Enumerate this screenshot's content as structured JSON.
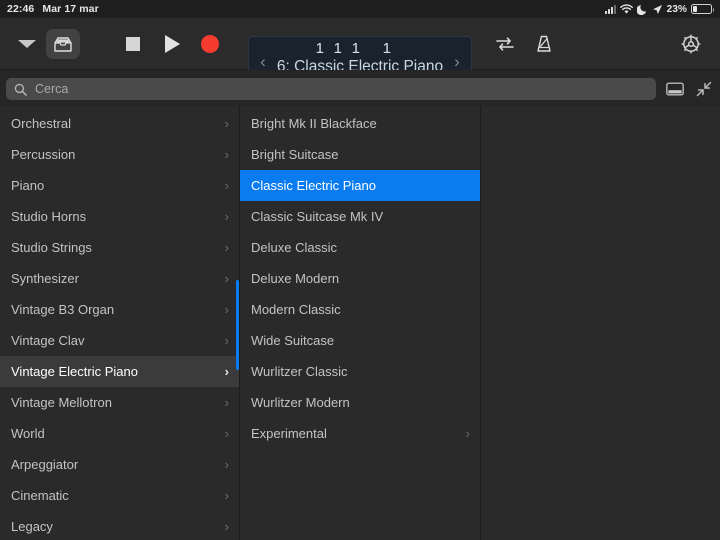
{
  "statusbar": {
    "time": "22:46",
    "date": "Mar 17 mar",
    "battery_percent": "23%",
    "icons": [
      "cellular-signal-icon",
      "wifi-icon",
      "moon-icon",
      "location-arrow-icon",
      "battery-icon"
    ]
  },
  "toolbar": {
    "chevron_down": "chevron-down-icon",
    "library_button": "library-icon",
    "stop_button": "stop-icon",
    "play_button": "play-icon",
    "record_button": "record-icon",
    "cycle_button": "cycle-icon",
    "metronome_button": "metronome-icon",
    "settings_button": "gear-icon",
    "accent_record_color": "#f53c2e"
  },
  "lcd": {
    "position": [
      "1",
      "1",
      "1",
      "1"
    ],
    "patch": "6: Classic Electric Piano",
    "prev_label": "‹",
    "next_label": "›",
    "background_color": "#1a222e"
  },
  "search": {
    "placeholder": "Cerca",
    "value": "",
    "icon": "search-icon",
    "keyboard_toggle_icon": "keyboard-hide-icon",
    "collapse_icon": "collapse-arrows-icon"
  },
  "browser": {
    "selection_color": "#0a7cf0",
    "categories": [
      {
        "label": "Orchestral",
        "has_children": true,
        "selected": false
      },
      {
        "label": "Percussion",
        "has_children": true,
        "selected": false
      },
      {
        "label": "Piano",
        "has_children": true,
        "selected": false
      },
      {
        "label": "Studio Horns",
        "has_children": true,
        "selected": false
      },
      {
        "label": "Studio Strings",
        "has_children": true,
        "selected": false
      },
      {
        "label": "Synthesizer",
        "has_children": true,
        "selected": false
      },
      {
        "label": "Vintage B3 Organ",
        "has_children": true,
        "selected": false
      },
      {
        "label": "Vintage Clav",
        "has_children": true,
        "selected": false
      },
      {
        "label": "Vintage Electric Piano",
        "has_children": true,
        "selected": true
      },
      {
        "label": "Vintage Mellotron",
        "has_children": true,
        "selected": false
      },
      {
        "label": "World",
        "has_children": true,
        "selected": false
      },
      {
        "label": "Arpeggiator",
        "has_children": true,
        "selected": false
      },
      {
        "label": "Cinematic",
        "has_children": true,
        "selected": false
      },
      {
        "label": "Legacy",
        "has_children": true,
        "selected": false
      }
    ],
    "patches": [
      {
        "label": "Bright Mk II Blackface",
        "has_children": false,
        "selected": false
      },
      {
        "label": "Bright Suitcase",
        "has_children": false,
        "selected": false
      },
      {
        "label": "Classic Electric Piano",
        "has_children": false,
        "selected": true
      },
      {
        "label": "Classic Suitcase Mk IV",
        "has_children": false,
        "selected": false
      },
      {
        "label": "Deluxe Classic",
        "has_children": false,
        "selected": false
      },
      {
        "label": "Deluxe Modern",
        "has_children": false,
        "selected": false
      },
      {
        "label": "Modern Classic",
        "has_children": false,
        "selected": false
      },
      {
        "label": "Wide Suitcase",
        "has_children": false,
        "selected": false
      },
      {
        "label": "Wurlitzer Classic",
        "has_children": false,
        "selected": false
      },
      {
        "label": "Wurlitzer Modern",
        "has_children": false,
        "selected": false
      },
      {
        "label": "Experimental",
        "has_children": true,
        "selected": false
      }
    ],
    "detail_items": []
  }
}
